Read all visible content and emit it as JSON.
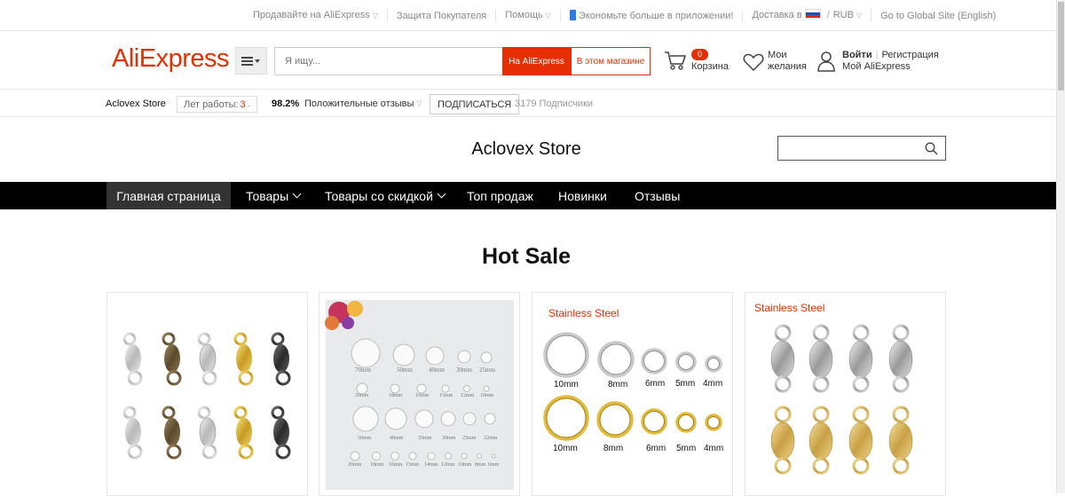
{
  "topbar": {
    "sell": "Продавайте на AliExpress",
    "protection": "Защита Покупателя",
    "help": "Помощь",
    "app": "Экономьте больше в приложении!",
    "ship_to": "Доставка в",
    "currency": "RUB",
    "global": "Go to Global Site (English)"
  },
  "header": {
    "logo": "AliExpress",
    "search_placeholder": "Я ищу...",
    "btn_aliexpress": "На AliExpress",
    "btn_store": "В этом магазине",
    "cart_count": "0",
    "cart_label": "Корзина",
    "wishlist_line1": "Мои",
    "wishlist_line2": "желания",
    "login": "Войти",
    "register": "Регистрация",
    "my_ae": "Мой AliExpress"
  },
  "storebar": {
    "name": "Aclovex Store",
    "years_label": "Лет работы:",
    "years_value": "3",
    "rating": "98.2%",
    "feedback": "Положительные отзывы",
    "subscribe": "ПОДПИСАТЬСЯ",
    "subscribers": "3179 Подписчики"
  },
  "store": {
    "title": "Aclovex Store"
  },
  "nav": {
    "home": "Главная страница",
    "products": "Товары",
    "sale": "Товары со скидкой",
    "top": "Топ продаж",
    "new": "Новинки",
    "reviews": "Отзывы"
  },
  "section": {
    "title": "Hot Sale"
  },
  "products": [
    {
      "id": "p1"
    },
    {
      "id": "p2",
      "sizes_top": [
        "70mm",
        "50mm",
        "40mm",
        "30mm",
        "25mm"
      ],
      "sizes_mid": [
        "20mm",
        "18mm",
        "16mm",
        "15mm",
        "12mm",
        "10mm"
      ],
      "sizes_b1": [
        "50mm",
        "40mm",
        "35mm",
        "30mm",
        "25mm",
        "22mm"
      ],
      "sizes_b2": [
        "20mm",
        "18mm",
        "16mm",
        "15mm",
        "14mm",
        "12mm",
        "10mm",
        "8mm",
        "6mm"
      ]
    },
    {
      "id": "p3",
      "heading": "Stainless Steel",
      "sizes": [
        "10mm",
        "8mm",
        "6mm",
        "5mm",
        "4mm"
      ]
    },
    {
      "id": "p4",
      "heading": "Stainless Steel"
    }
  ],
  "colors": {
    "brand": "#e62e04",
    "nav_bg": "#000000",
    "nav_active": "#333333"
  }
}
